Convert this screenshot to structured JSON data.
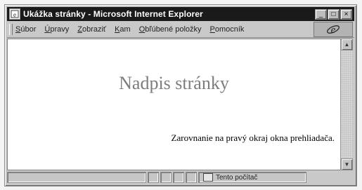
{
  "window": {
    "title": "Ukážka stránky - Microsoft Internet Explorer",
    "controls": {
      "minimize": "_",
      "maximize": "□",
      "close": "×"
    }
  },
  "menu": {
    "items": [
      {
        "underline": "S",
        "rest": "úbor"
      },
      {
        "underline": "Ú",
        "rest": "pravy"
      },
      {
        "underline": "Z",
        "rest": "obraziť"
      },
      {
        "underline": "K",
        "rest": "am"
      },
      {
        "underline": "O",
        "rest": "bľúbené položky"
      },
      {
        "underline": "P",
        "rest": "omocník"
      }
    ]
  },
  "page": {
    "heading": "Nadpis stránky",
    "paragraph": "Zarovnanie na pravý okraj okna prehliadača."
  },
  "status": {
    "zone": "Tento počítač"
  },
  "icons": {
    "title": "ie-page-icon",
    "logo": "ie-logo-icon",
    "zone": "computer-icon"
  },
  "colors": {
    "titlebar": "#1a1a1a",
    "heading": "#7d7d7d",
    "chrome": "#c9c9c9"
  }
}
